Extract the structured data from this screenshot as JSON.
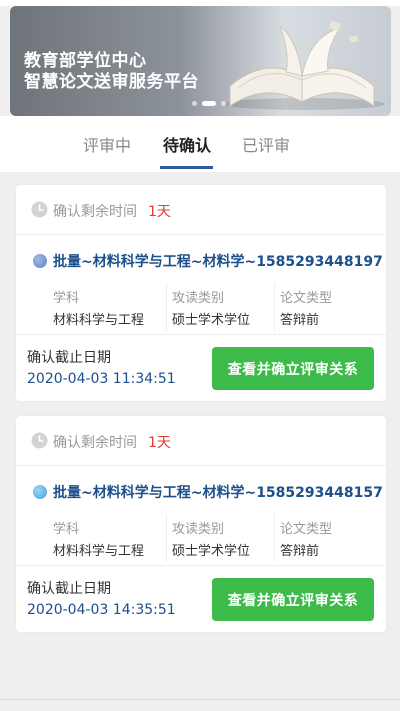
{
  "banner": {
    "line1": "教育部学位中心",
    "line2": "智慧论文送审服务平台",
    "slides": 3,
    "active_slide": 2
  },
  "tabs": [
    {
      "label": "评审中",
      "active": false
    },
    {
      "label": "待确认",
      "active": true
    },
    {
      "label": "已评审",
      "active": false
    }
  ],
  "cards": [
    {
      "time_label": "确认剩余时间",
      "time_value": "1天",
      "title": "批量~材料科学与工程~材料学~1585293448197",
      "dot_color": "#5b86c4",
      "columns": [
        {
          "header": "学科",
          "value": "材料科学与工程"
        },
        {
          "header": "攻读类别",
          "value": "硕士学术学位"
        },
        {
          "header": "论文类型",
          "value": "答辩前"
        }
      ],
      "deadline_label": "确认截止日期",
      "deadline_value": "2020-04-03 11:34:51",
      "button_label": "查看并确立评审关系"
    },
    {
      "time_label": "确认剩余时间",
      "time_value": "1天",
      "title": "批量~材料科学与工程~材料学~1585293448157",
      "dot_color": "#3fa3e0",
      "columns": [
        {
          "header": "学科",
          "value": "材料科学与工程"
        },
        {
          "header": "攻读类别",
          "value": "硕士学术学位"
        },
        {
          "header": "论文类型",
          "value": "答辩前"
        }
      ],
      "deadline_label": "确认截止日期",
      "deadline_value": "2020-04-03 14:35:51",
      "button_label": "查看并确立评审关系"
    }
  ],
  "colors": {
    "accent": "#2b5fa0",
    "button": "#3dbb4a",
    "warning_text": "#e33b2f",
    "title_text": "#1d4f8b"
  },
  "icons": {
    "clock": "clock-icon",
    "book": "open-book-icon"
  }
}
